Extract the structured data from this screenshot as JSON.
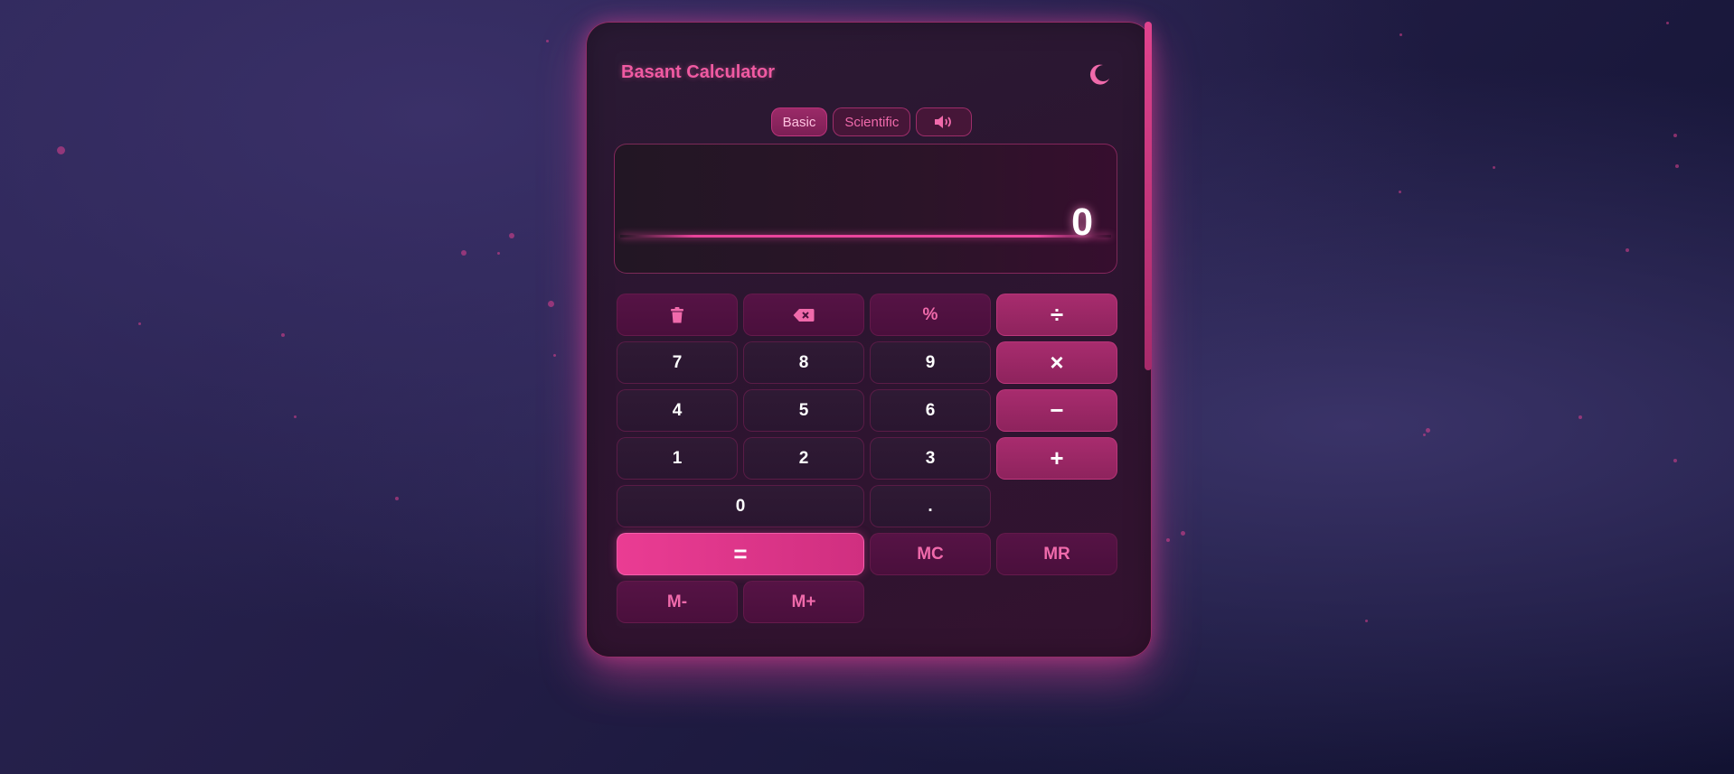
{
  "app": {
    "title": "Basant Calculator"
  },
  "modes": {
    "basic": "Basic",
    "scientific": "Scientific",
    "active": "Basic",
    "sound_icon": "volume-icon"
  },
  "display": {
    "expression": "",
    "value": "0"
  },
  "keys": {
    "clear_icon": "trash-icon",
    "backspace_icon": "backspace-icon",
    "percent": "%",
    "divide": "÷",
    "seven": "7",
    "eight": "8",
    "nine": "9",
    "multiply": "×",
    "four": "4",
    "five": "5",
    "six": "6",
    "subtract": "−",
    "one": "1",
    "two": "2",
    "three": "3",
    "add": "+",
    "zero": "0",
    "decimal": ".",
    "equals": "=",
    "mc": "MC",
    "mr": "MR",
    "m_minus": "M-",
    "m_plus": "M+"
  },
  "theme": {
    "accent": "#e8439a",
    "toggle_icon": "moon-icon"
  }
}
